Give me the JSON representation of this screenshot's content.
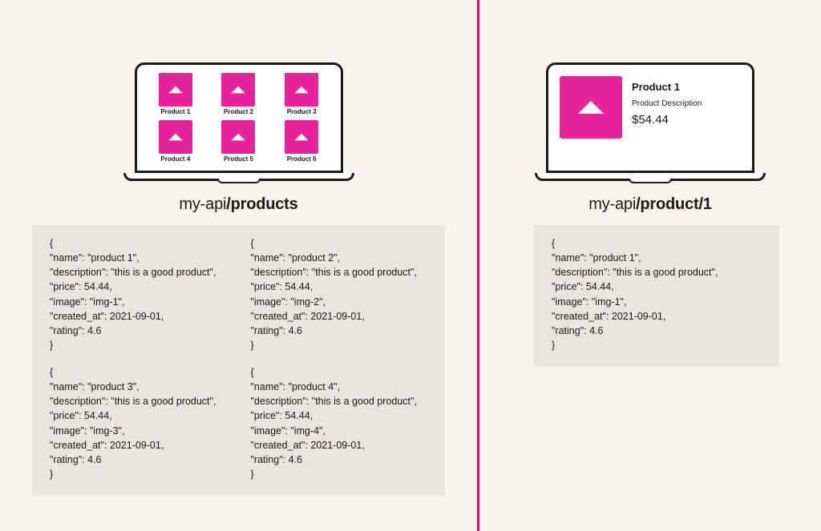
{
  "colors": {
    "accent": "#e6007e",
    "tile": "#e6239b",
    "bg": "#f7f3ed",
    "codebg": "#e8e5df"
  },
  "left": {
    "grid": [
      {
        "label": "Product 1"
      },
      {
        "label": "Product 2"
      },
      {
        "label": "Product 3"
      },
      {
        "label": "Product 4"
      },
      {
        "label": "Product 5"
      },
      {
        "label": "Product 6"
      }
    ],
    "endpoint_prefix": "my-api",
    "endpoint_bold": "/products",
    "json_samples": [
      "{\n\"name\": \"product 1\",\n\"description\": \"this is a good product\",\n\"price\": 54.44,\n\"image\": \"img-1\",\n\"created_at\": 2021-09-01,\n\"rating\": 4.6\n}",
      "{\n\"name\": \"product 2\",\n\"description\": \"this is a good product\",\n\"price\": 54.44,\n\"image\": \"img-2\",\n\"created_at\": 2021-09-01,\n\"rating\": 4.6\n}",
      "{\n\"name\": \"product 3\",\n\"description\": \"this is a good product\",\n\"price\": 54.44,\n\"image\": \"img-3\",\n\"created_at\": 2021-09-01,\n\"rating\": 4.6\n}",
      "{\n\"name\": \"product 4\",\n\"description\": \"this is a good product\",\n\"price\": 54.44,\n\"image\": \"img-4\",\n\"created_at\": 2021-09-01,\n\"rating\": 4.6\n}"
    ]
  },
  "right": {
    "detail": {
      "title": "Product 1",
      "description": "Product Description",
      "price": "$54.44"
    },
    "endpoint_prefix": "my-api",
    "endpoint_bold": "/product/1",
    "json_sample": "{\n\"name\": \"product 1\",\n\"description\": \"this is a good product\",\n\"price\": 54.44,\n\"image\": \"img-1\",\n\"created_at\": 2021-09-01,\n\"rating\": 4.6\n}"
  }
}
